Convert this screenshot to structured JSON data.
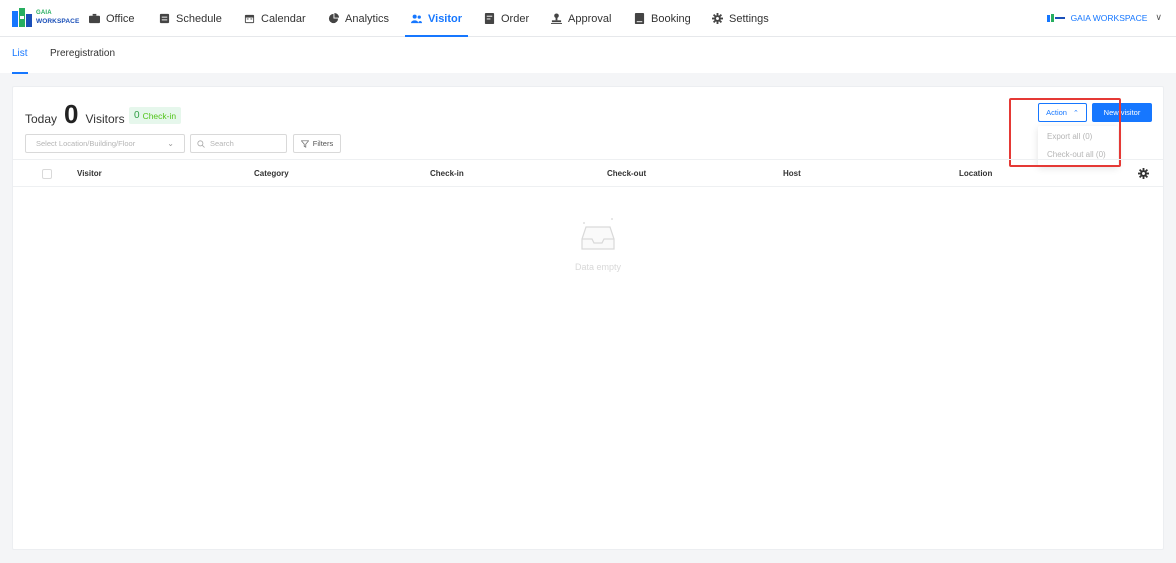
{
  "brand": {
    "line1": "GAIA",
    "line2": "WORKSPACE"
  },
  "nav": {
    "items": [
      {
        "label": "Office",
        "icon": "briefcase-icon"
      },
      {
        "label": "Schedule",
        "icon": "schedule-icon"
      },
      {
        "label": "Calendar",
        "icon": "calendar-icon"
      },
      {
        "label": "Analytics",
        "icon": "pie-chart-icon"
      },
      {
        "label": "Visitor",
        "icon": "users-icon",
        "active": true
      },
      {
        "label": "Order",
        "icon": "order-icon"
      },
      {
        "label": "Approval",
        "icon": "approval-icon"
      },
      {
        "label": "Booking",
        "icon": "booking-icon"
      },
      {
        "label": "Settings",
        "icon": "gear-icon"
      }
    ],
    "workspace": "GAIA WORKSPACE"
  },
  "subtabs": {
    "list": "List",
    "prereg": "Preregistration"
  },
  "summary": {
    "today_label": "Today",
    "count": "0",
    "visitors_label": "Visitors",
    "checkin_count": "0",
    "checkin_label": "Check-in"
  },
  "filters": {
    "location_placeholder": "Select Location/Building/Floor",
    "search_placeholder": "Search",
    "filters_label": "Filters"
  },
  "actions": {
    "action_label": "Action",
    "new_visitor_label": "New visitor",
    "menu": [
      "Export all (0)",
      "Check-out all (0)"
    ]
  },
  "table": {
    "columns": [
      "Visitor",
      "Category",
      "Check-in",
      "Check-out",
      "Host",
      "Location"
    ]
  },
  "empty": {
    "text": "Data empty"
  },
  "colors": {
    "accent": "#1677ff",
    "highlight": "#e53935",
    "badge_bg": "#e6f7ec"
  }
}
